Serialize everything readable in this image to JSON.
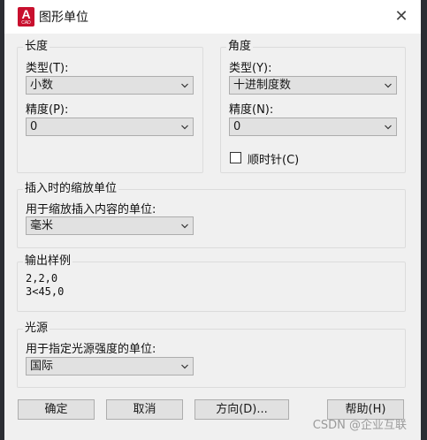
{
  "window": {
    "title": "图形单位",
    "app_icon_letter": "A",
    "app_icon_sub": "CAD",
    "close_glyph": "✕"
  },
  "length": {
    "group_label": "长度",
    "type_label": "类型(T):",
    "type_value": "小数",
    "precision_label": "精度(P):",
    "precision_value": "0"
  },
  "angle": {
    "group_label": "角度",
    "type_label": "类型(Y):",
    "type_value": "十进制度数",
    "precision_label": "精度(N):",
    "precision_value": "0",
    "clockwise_label": "顺时针(C)",
    "clockwise_checked": false
  },
  "insertion": {
    "group_label": "插入时的缩放单位",
    "desc": "用于缩放插入内容的单位:",
    "value": "毫米"
  },
  "sample": {
    "group_label": "输出样例",
    "line1": "2,2,0",
    "line2": "3<45,0"
  },
  "lighting": {
    "group_label": "光源",
    "desc": "用于指定光源强度的单位:",
    "value": "国际"
  },
  "buttons": {
    "ok": "确定",
    "cancel": "取消",
    "direction": "方向(D)...",
    "help": "帮助(H)"
  },
  "watermark": "CSDN @企业互联"
}
